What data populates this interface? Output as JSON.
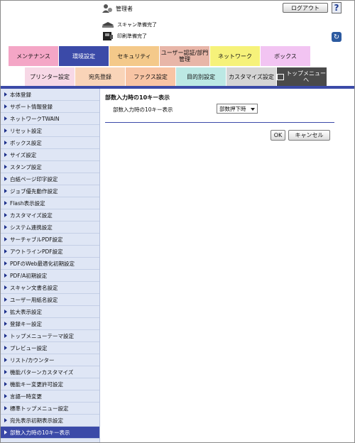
{
  "header": {
    "admin_label": "管理者",
    "logout_label": "ログアウト",
    "help_label": "?",
    "scan_status": "スキャン準備完了",
    "print_status": "印刷準備完了"
  },
  "tabs_row1": [
    {
      "label": "メンテナンス",
      "color": "#f4a6c6",
      "active": false
    },
    {
      "label": "環境設定",
      "color": "#3b4aa8",
      "active": true
    },
    {
      "label": "セキュリティ",
      "color": "#f4c98a",
      "active": false
    },
    {
      "label": "ユーザー認証/部門管理",
      "color": "#e8b6a8",
      "active": false
    },
    {
      "label": "ネットワーク",
      "color": "#f6f27a",
      "active": false
    },
    {
      "label": "ボックス",
      "color": "#f2c4f2",
      "active": false
    }
  ],
  "tabs_row2": [
    {
      "label": "プリンター設定",
      "color": "#f7d8e6"
    },
    {
      "label": "宛先登録",
      "color": "#f9d4b8"
    },
    {
      "label": "ファクス設定",
      "color": "#f8c4a4"
    },
    {
      "label": "目的別設定",
      "color": "#bce8e4"
    },
    {
      "label": "カスタマイズ設定",
      "color": "#d4d4d4"
    },
    {
      "label": "トップメニューへ",
      "color": "#4a4a4a"
    }
  ],
  "sidebar": {
    "items": [
      "本体登録",
      "サポート情報登録",
      "ネットワークTWAIN",
      "リセット設定",
      "ボックス設定",
      "サイズ設定",
      "スタンプ設定",
      "白紙ページ印字設定",
      "ジョブ優先動作設定",
      "Flash表示設定",
      "カスタマイズ設定",
      "システム連携設定",
      "サーチャブルPDF設定",
      "アウトラインPDF設定",
      "PDFのWeb最適化初期設定",
      "PDF/A初期設定",
      "スキャン文書名設定",
      "ユーザー用紙名設定",
      "拡大表示設定",
      "登録キー設定",
      "トップメニューテーマ設定",
      "プレビュー設定",
      "リスト/カウンター",
      "機能パターンカスタマイズ",
      "機能キー変更許可設定",
      "言語一時変更",
      "標準トップメニュー設定",
      "宛先表示初期表示設定",
      "部数入力時の10キー表示"
    ],
    "active_index": 28
  },
  "main": {
    "title": "部数入力時の10キー表示",
    "setting_label": "部数入力時の10キー表示",
    "setting_value": "部数押下時",
    "ok_label": "OK",
    "cancel_label": "キャンセル"
  },
  "colors": {
    "accent": "#3b4aa8",
    "sidebar_bg": "#dfe6f5"
  }
}
